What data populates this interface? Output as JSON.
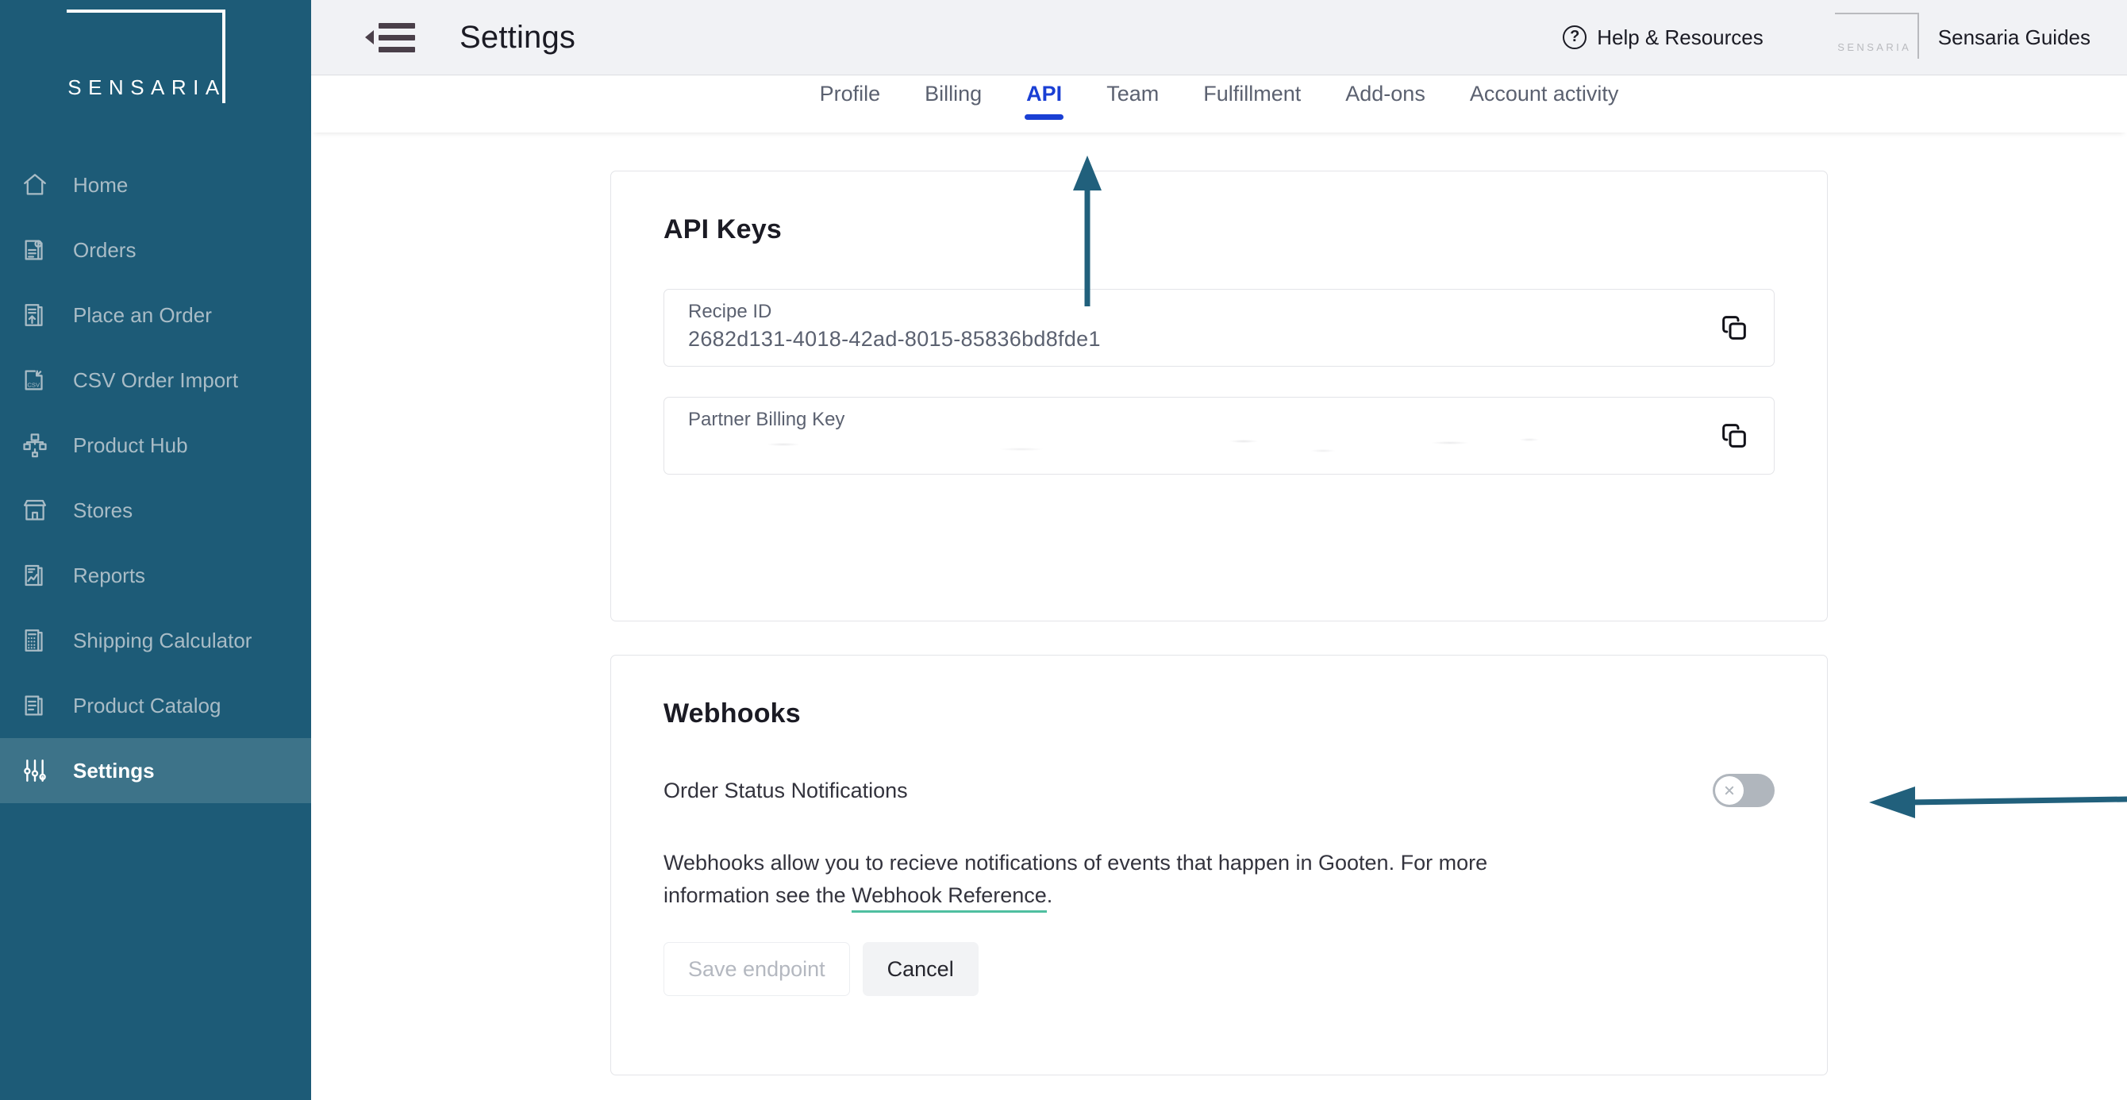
{
  "sidebar": {
    "logo_text": "SENSARIA",
    "items": [
      {
        "label": "Home",
        "icon": "home-icon"
      },
      {
        "label": "Orders",
        "icon": "orders-icon"
      },
      {
        "label": "Place an Order",
        "icon": "place-order-icon"
      },
      {
        "label": "CSV Order Import",
        "icon": "csv-import-icon"
      },
      {
        "label": "Product Hub",
        "icon": "product-hub-icon"
      },
      {
        "label": "Stores",
        "icon": "stores-icon"
      },
      {
        "label": "Reports",
        "icon": "reports-icon"
      },
      {
        "label": "Shipping Calculator",
        "icon": "shipping-calculator-icon"
      },
      {
        "label": "Product Catalog",
        "icon": "product-catalog-icon"
      },
      {
        "label": "Settings",
        "icon": "settings-sliders-icon"
      }
    ],
    "active_item": "Settings",
    "bg_color": "#1d5b77",
    "active_bg_color": "#3d7389"
  },
  "header": {
    "menu_icon": "hamburger-collapse-icon",
    "title": "Settings",
    "help_label": "Help & Resources",
    "help_icon": "question-circle-icon",
    "guides_label": "Sensaria Guides",
    "guides_logo_text": "SENSARIA"
  },
  "tabs": {
    "items": [
      {
        "label": "Profile"
      },
      {
        "label": "Billing"
      },
      {
        "label": "API"
      },
      {
        "label": "Team"
      },
      {
        "label": "Fulfillment"
      },
      {
        "label": "Add-ons"
      },
      {
        "label": "Account activity"
      }
    ],
    "active": "API",
    "active_color": "#1a3fd4"
  },
  "api_keys": {
    "title": "API Keys",
    "fields": [
      {
        "label": "Recipe ID",
        "value": "2682d131-4018-42ad-8015-85836bd8fde1",
        "redacted": false,
        "copy_icon": "copy-icon"
      },
      {
        "label": "Partner Billing Key",
        "value": "",
        "redacted": true,
        "copy_icon": "copy-icon"
      }
    ]
  },
  "webhooks": {
    "title": "Webhooks",
    "toggle_label": "Order Status Notifications",
    "toggle_state": "off",
    "toggle_icon": "x-icon",
    "description_before_link": "Webhooks allow you to recieve notifications of events that happen in Gooten. For more information see the ",
    "link_label": "Webhook Reference",
    "description_after_link": ".",
    "link_underline_color": "#4fbfa0",
    "save_button": "Save endpoint",
    "save_button_state": "disabled",
    "cancel_button": "Cancel"
  },
  "annotations": {
    "color": "#21607c",
    "arrow_up_target": "API tab",
    "arrow_left_target": "Order Status Notifications toggle"
  }
}
